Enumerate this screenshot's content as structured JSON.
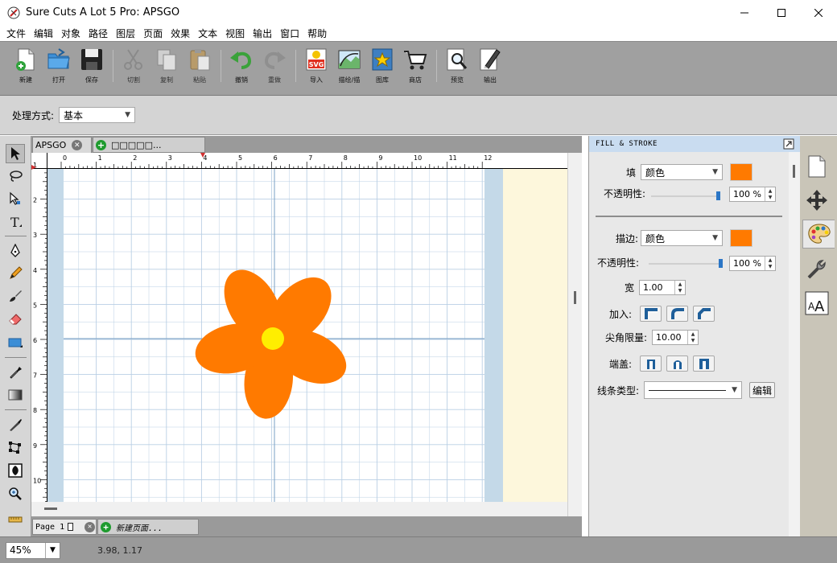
{
  "window": {
    "title": "Sure Cuts A Lot 5 Pro: APSGO",
    "minimize_icon": "minimize-icon",
    "maximize_icon": "maximize-icon",
    "close_icon": "close-icon"
  },
  "menu": [
    "文件",
    "编辑",
    "对象",
    "路径",
    "图层",
    "页面",
    "效果",
    "文本",
    "视图",
    "输出",
    "窗口",
    "帮助"
  ],
  "toolbar": {
    "new": "新建",
    "open": "打开",
    "save": "保存",
    "cut": "切割",
    "copy": "复制",
    "paste": "粘贴",
    "undo": "撤销",
    "redo": "重做",
    "import": "导入",
    "trace": "描绘/描",
    "library": "图库",
    "store": "商店",
    "preview": "预览",
    "output": "输出"
  },
  "process": {
    "label": "处理方式:",
    "value": "基本"
  },
  "document": {
    "tab_name": "APSGO",
    "new_tab_label": "□□□□□...",
    "page_tab": "Page 1",
    "new_page_label": "新建页面...",
    "ruler_top": [
      "0",
      "1",
      "2",
      "3",
      "4",
      "5",
      "6",
      "7",
      "8",
      "9",
      "10",
      "11",
      "12"
    ],
    "ruler_left": [
      "1",
      "2",
      "3",
      "4",
      "5",
      "6",
      "7",
      "8",
      "9",
      "10"
    ]
  },
  "panel": {
    "title": "FILL & STROKE",
    "fill_label": "填",
    "fill_type": "颜色",
    "fill_color": "#ff7a00",
    "fill_opacity_label": "不透明性:",
    "fill_opacity": "100 %",
    "fill_opacity_level": 1.0,
    "stroke_label": "描边:",
    "stroke_type": "颜色",
    "stroke_color": "#ff7a00",
    "stroke_opacity_label": "不透明性:",
    "stroke_opacity": "100 %",
    "stroke_opacity_level": 1.0,
    "width_label": "宽",
    "width_value": "1.00",
    "join_label": "加入:",
    "miter_label": "尖角限量:",
    "miter_value": "10.00",
    "cap_label": "端盖:",
    "line_type_label": "线条类型:",
    "edit_label": "编辑"
  },
  "status": {
    "zoom": "45%",
    "coords": "3.98, 1.17"
  },
  "colors": {
    "flower_petals": "#ff7a00",
    "flower_center": "#ffee00",
    "grid_line": "#b9cfe4",
    "page_margin": "#c4d9e8",
    "offpage": "#fdf7dc"
  }
}
